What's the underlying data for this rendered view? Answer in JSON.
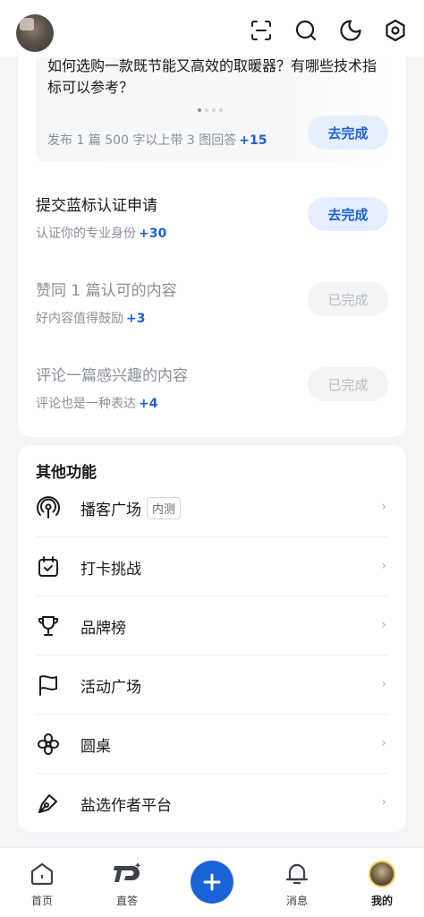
{
  "header": {
    "icons": [
      "avatar",
      "scan-icon",
      "search-icon",
      "moon-icon",
      "settings-icon"
    ]
  },
  "tasks": {
    "question": {
      "text": "如何选购一款既节能又高效的取暖器？有哪些技术指标可以参考？",
      "sub": "发布 1 篇 500 字以上带 3 图回答",
      "bonus": "+15",
      "button": "去完成"
    },
    "items": [
      {
        "title": "提交蓝标认证申请",
        "sub": "认证你的专业身份",
        "bonus": "+30",
        "button": "去完成",
        "status": "todo"
      },
      {
        "title": "赞同 1 篇认可的内容",
        "sub": "好内容值得鼓励",
        "bonus": "+3",
        "button": "已完成",
        "status": "done"
      },
      {
        "title": "评论一篇感兴趣的内容",
        "sub": "评论也是一种表达",
        "bonus": "+4",
        "button": "已完成",
        "status": "done"
      }
    ]
  },
  "functions": {
    "title": "其他功能",
    "items": [
      {
        "label": "播客广场",
        "tag": "内测",
        "icon": "podcast-icon"
      },
      {
        "label": "打卡挑战",
        "tag": "",
        "icon": "calendar-check-icon"
      },
      {
        "label": "品牌榜",
        "tag": "",
        "icon": "trophy-icon"
      },
      {
        "label": "活动广场",
        "tag": "",
        "icon": "flag-icon"
      },
      {
        "label": "圆桌",
        "tag": "",
        "icon": "flower-icon"
      },
      {
        "label": "盐选作者平台",
        "tag": "",
        "icon": "pen-icon"
      }
    ],
    "chevron": "›"
  },
  "nav": {
    "items": [
      {
        "label": "首页",
        "icon": "home-icon"
      },
      {
        "label": "直答",
        "icon": "zhida-icon"
      },
      {
        "label": "",
        "icon": "plus-icon"
      },
      {
        "label": "消息",
        "icon": "bell-icon"
      },
      {
        "label": "我的",
        "icon": "avatar-icon"
      }
    ],
    "active": "我的",
    "accent": "#1a63d6"
  }
}
